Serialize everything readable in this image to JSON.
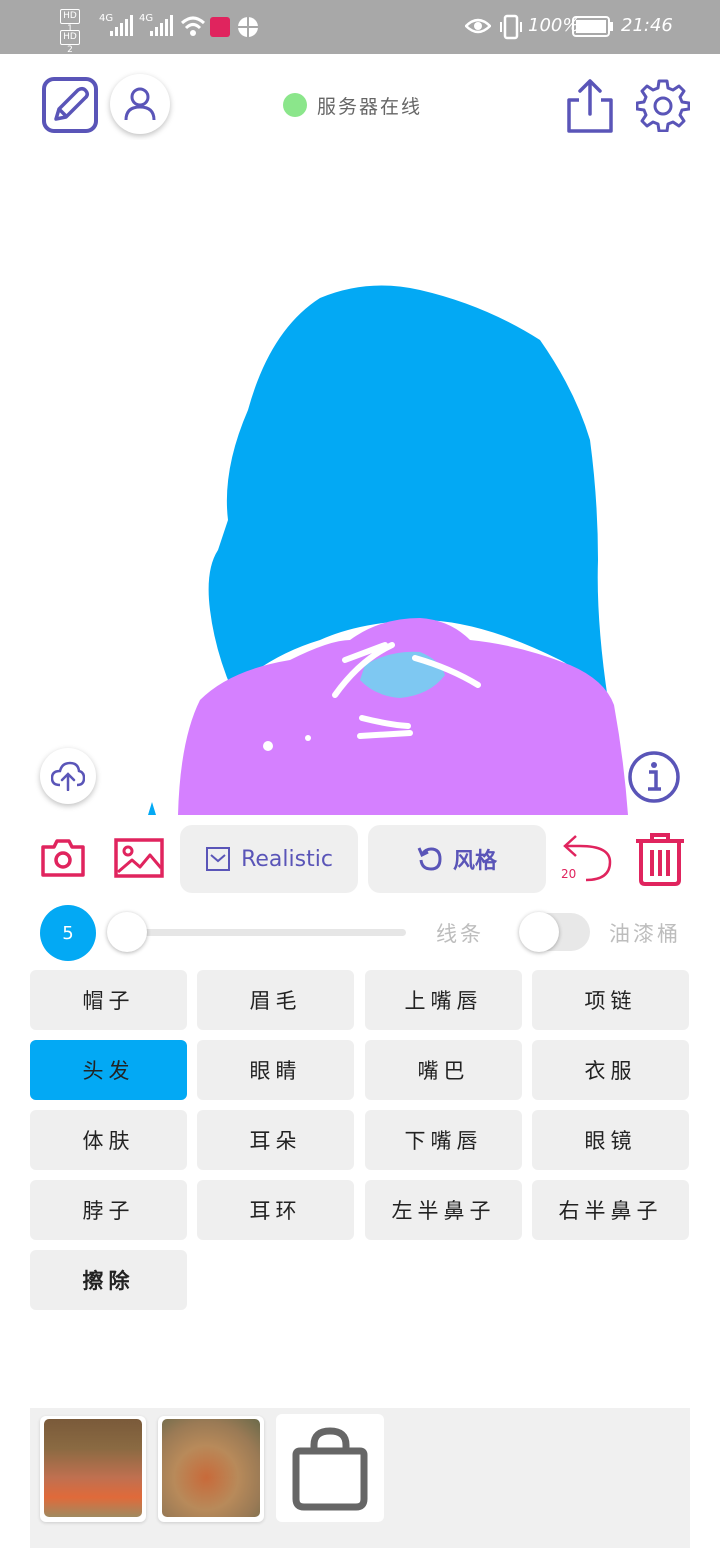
{
  "status_bar": {
    "sim1": "HD 1",
    "sim2": "HD 2",
    "network1": "4G",
    "network2": "4G",
    "battery_percent": "100%",
    "time": "21:46"
  },
  "header": {
    "server_status": "服务器在线",
    "server_status_color": "#8be68b",
    "icons": [
      "edit-icon",
      "user-icon",
      "share-icon",
      "settings-icon",
      "coffee-icon"
    ]
  },
  "canvas": {
    "colors": {
      "hair": "#03a9f4",
      "clothes": "#d580ff",
      "skin": "#ffffff"
    },
    "icons": [
      "upload-cloud-icon",
      "info-icon"
    ]
  },
  "toolbar": {
    "realistic_label": "Realistic",
    "style_label": "风格",
    "undo_count": "20",
    "icons": [
      "camera-icon",
      "image-icon",
      "checkbox-icon",
      "refresh-icon",
      "undo-icon",
      "trash-icon"
    ]
  },
  "brush": {
    "size": "5",
    "slider_value": 0,
    "line_label": "线条",
    "bucket_label": "油漆桶",
    "bucket_enabled": false
  },
  "labels": {
    "active": "头发",
    "items": [
      "帽子",
      "眉毛",
      "上嘴唇",
      "项链",
      "头发",
      "眼睛",
      "嘴巴",
      "衣服",
      "体肤",
      "耳朵",
      "下嘴唇",
      "眼镜",
      "脖子",
      "耳环",
      "左半鼻子",
      "右半鼻子",
      "擦除"
    ]
  },
  "gallery": {
    "icons": [
      "bag-icon"
    ],
    "thumbnail_count": 2
  },
  "theme": {
    "accent": "#03a9f4",
    "primary": "#5a55b8",
    "danger": "#e0245e"
  }
}
